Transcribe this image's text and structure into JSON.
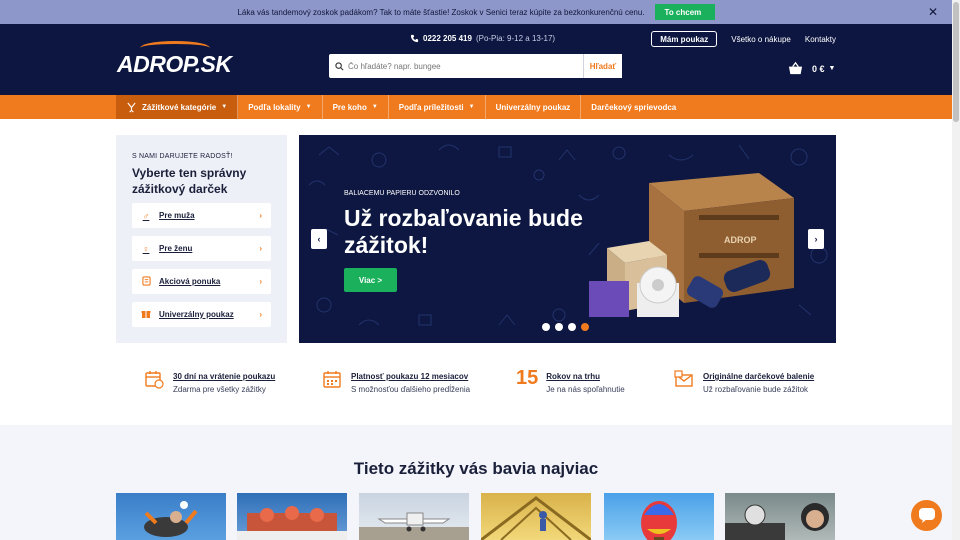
{
  "promo": {
    "text": "Láka vás tandemový zoskok padákom? Tak to máte šťastie! Zoskok v Senici teraz kúpite za bezkonkurenčnú cenu.",
    "cta": "To chcem",
    "close": "✕"
  },
  "header": {
    "logo": "ADROP.SK",
    "phone": "0222 205 419",
    "hours": "(Po-Pia: 9-12 a 13-17)",
    "voucher_button": "Mám poukaz",
    "links": [
      "Všetko o nákupe",
      "Kontakty"
    ],
    "search": {
      "placeholder": "Čo hľadáte? napr. bungee",
      "button": "Hľadať"
    },
    "cart": {
      "total": "0 €"
    }
  },
  "nav": {
    "items": [
      {
        "label": "Zážitkové kategórie",
        "has_dropdown": true,
        "active": true
      },
      {
        "label": "Podľa lokality",
        "has_dropdown": true
      },
      {
        "label": "Pre koho",
        "has_dropdown": true
      },
      {
        "label": "Podľa príležitosti",
        "has_dropdown": true
      },
      {
        "label": "Univerzálny poukaz",
        "has_dropdown": false
      },
      {
        "label": "Darčekový sprievodca",
        "has_dropdown": false
      }
    ]
  },
  "sidepanel": {
    "eyebrow": "S NAMI DARUJETE RADOSŤ!",
    "title": "Vyberte ten správny zážitkový darček",
    "items": [
      {
        "label": "Pre muža",
        "icon": "male-icon"
      },
      {
        "label": "Pre ženu",
        "icon": "female-icon"
      },
      {
        "label": "Akciová ponuka",
        "icon": "sale-tag-icon"
      },
      {
        "label": "Univerzálny poukaz",
        "icon": "gift-icon"
      }
    ]
  },
  "banner": {
    "eyebrow": "BALIACEMU PAPIERU ODZVONILO",
    "title": "Už rozbaľovanie bude zážitok!",
    "cta": "Viac >",
    "box_label": "ADROP",
    "dots": 4,
    "active_dot": 3
  },
  "features": [
    {
      "title": "30 dní na vrátenie poukazu",
      "sub": "Zdarma pre všetky zážitky",
      "icon": "calendar-return-icon"
    },
    {
      "title": "Platnosť poukazu 12 mesiacov",
      "sub": "S možnosťou ďalšieho predĺženia",
      "icon": "calendar-icon"
    },
    {
      "number": "15",
      "title": "Rokov na trhu",
      "sub": "Je na nás spoľahnutie"
    },
    {
      "title": "Originálne darčekové balenie",
      "sub": "Už rozbaľovanie bude zážitok",
      "icon": "gift-envelope-icon"
    }
  ],
  "popular": {
    "title": "Tieto zážitky vás bavia najviac",
    "thumbs": [
      "skydiving",
      "rescue-team",
      "airplane",
      "aviator-hangar",
      "hot-air-balloon",
      "helicopter-pilot"
    ]
  },
  "colors": {
    "navy": "#0c1640",
    "orange": "#f07a1e",
    "green": "#1bb05b",
    "promo_bg": "#8e97c9"
  }
}
